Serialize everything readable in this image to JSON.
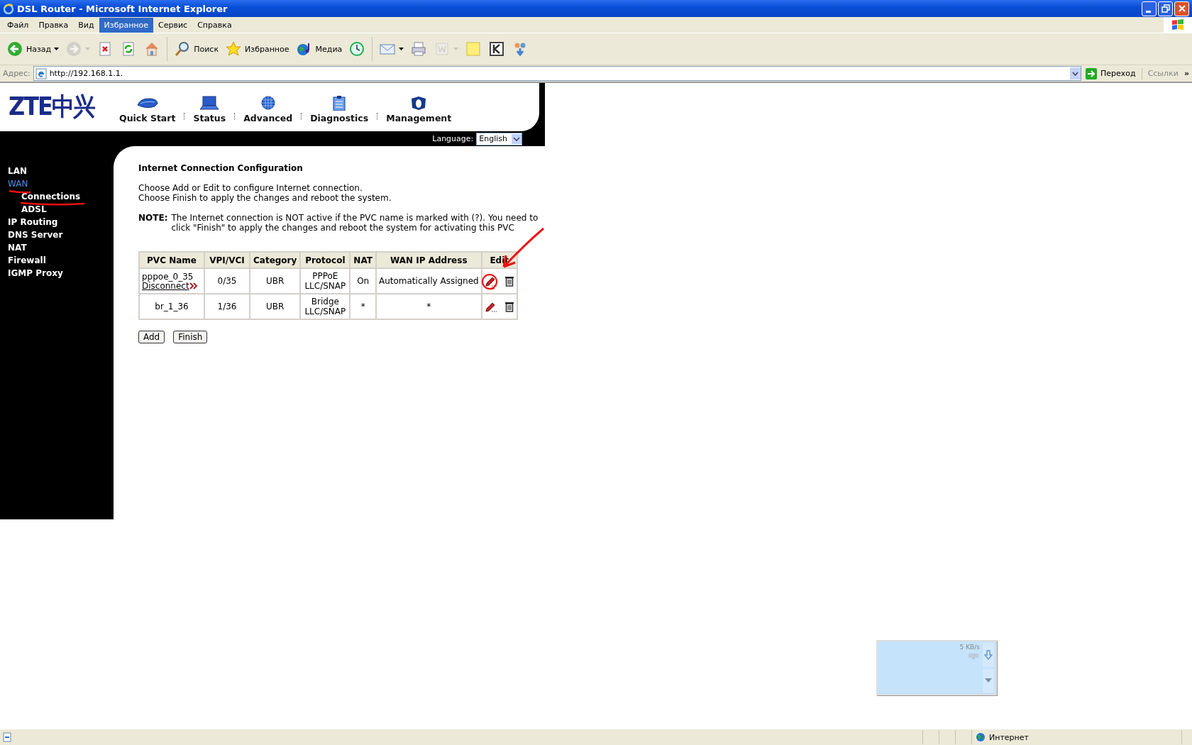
{
  "window": {
    "title": "DSL Router - Microsoft Internet Explorer"
  },
  "menu": [
    {
      "label": "Файл",
      "selected": false
    },
    {
      "label": "Правка",
      "selected": false
    },
    {
      "label": "Вид",
      "selected": false
    },
    {
      "label": "Избранное",
      "selected": true
    },
    {
      "label": "Сервис",
      "selected": false
    },
    {
      "label": "Справка",
      "selected": false
    }
  ],
  "toolbar": {
    "groups": [
      [
        {
          "label": "Назад",
          "dropdown": true,
          "disabled": false
        },
        {
          "dropdown": true,
          "disabled": true
        },
        {
          "dropdown": false,
          "disabled": false
        },
        {
          "dropdown": false,
          "disabled": false
        },
        {
          "dropdown": false,
          "disabled": false
        }
      ],
      [
        {
          "label": "Поиск",
          "dropdown": false,
          "disabled": false
        },
        {
          "label": "Избранное",
          "dropdown": false,
          "disabled": false
        },
        {
          "label": "Медиа",
          "dropdown": false,
          "disabled": false
        },
        {
          "dropdown": false,
          "disabled": false
        }
      ],
      [
        {
          "dropdown": true,
          "disabled": false
        },
        {
          "dropdown": false,
          "disabled": false
        },
        {
          "dropdown": true,
          "disabled": true
        },
        {
          "dropdown": false,
          "disabled": false
        },
        {
          "dropdown": false,
          "disabled": false
        },
        {
          "dropdown": false,
          "disabled": false
        }
      ]
    ]
  },
  "address_bar": {
    "label": "Адрес:",
    "url": "http://192.168.1.1.",
    "go_button": "Переход",
    "links": "Ссылки",
    "more": "»"
  },
  "router": {
    "logo": "ZTE中兴",
    "nav": [
      {
        "label": "Quick Start"
      },
      {
        "label": "Status"
      },
      {
        "label": "Advanced"
      },
      {
        "label": "Diagnostics"
      },
      {
        "label": "Management"
      }
    ],
    "language": {
      "label": "Language:",
      "value": "English"
    },
    "sidebar": [
      {
        "label": "LAN",
        "selected": false
      },
      {
        "label": "WAN",
        "selected": true,
        "children": [
          {
            "label": "Connections",
            "selected": false
          },
          {
            "label": "ADSL",
            "selected": false
          }
        ]
      },
      {
        "label": "IP Routing",
        "selected": false
      },
      {
        "label": "DNS Server",
        "selected": false
      },
      {
        "label": "NAT",
        "selected": false
      },
      {
        "label": "Firewall",
        "selected": false
      },
      {
        "label": "IGMP Proxy",
        "selected": false
      }
    ],
    "heading": "Internet Connection Configuration",
    "instructions": [
      "Choose Add or Edit to configure Internet connection.",
      "Choose Finish to apply the changes and reboot the system."
    ],
    "note": {
      "label": "NOTE:",
      "text": "The Internet connection is NOT active if the PVC name is marked with (?). You need to click \"Finish\" to apply the changes and reboot the system for activating this PVC"
    },
    "table": {
      "columns": [
        "PVC Name",
        "VPI/VCI",
        "Category",
        "Protocol",
        "NAT",
        "WAN IP Address",
        "Edit"
      ],
      "rows": [
        {
          "pvc_name": "pppoe_0_35",
          "action_link": "Disconnect",
          "vpi_vci": "0/35",
          "category": "UBR",
          "protocol": "PPPoE LLC/SNAP",
          "nat": "On",
          "wan_ip": "Automatically Assigned"
        },
        {
          "pvc_name": "br_1_36",
          "vpi_vci": "1/36",
          "category": "UBR",
          "protocol": "Bridge LLC/SNAP",
          "nat": "*",
          "wan_ip": "*"
        }
      ]
    },
    "buttons": [
      "Add",
      "Finish"
    ]
  },
  "speed_widget": {
    "rate": "5 KB/s"
  },
  "status_bar": {
    "zone": "Интернет"
  }
}
